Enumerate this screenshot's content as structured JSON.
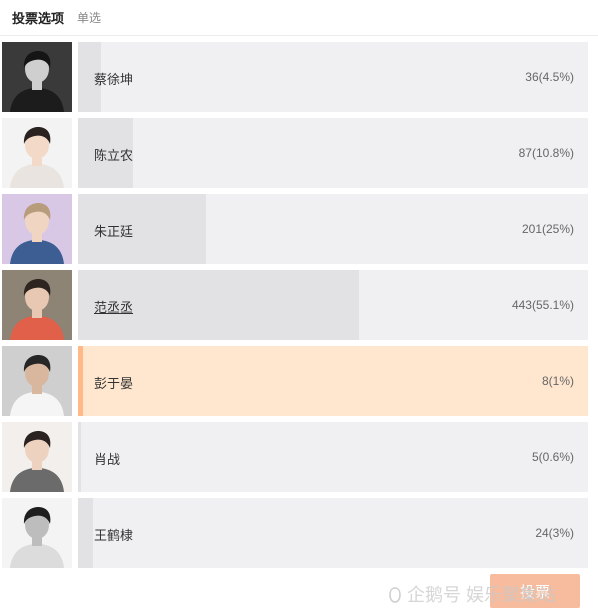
{
  "header": {
    "title": "投票选项",
    "mode": "单选"
  },
  "options": [
    {
      "name": "蔡徐坤",
      "votes": 36,
      "percent": 4.5,
      "stat": "36(4.5%)",
      "selected": false,
      "underlined": false,
      "avatar": {
        "bg": "#3a3a3a",
        "shirt": "#1c1c1c",
        "skin": "#cfcfcf",
        "hair": "#151515"
      }
    },
    {
      "name": "陈立农",
      "votes": 87,
      "percent": 10.8,
      "stat": "87(10.8%)",
      "selected": false,
      "underlined": false,
      "avatar": {
        "bg": "#f3f3f3",
        "shirt": "#e9e4e0",
        "skin": "#f3d9c7",
        "hair": "#2a2220"
      }
    },
    {
      "name": "朱正廷",
      "votes": 201,
      "percent": 25,
      "stat": "201(25%)",
      "selected": false,
      "underlined": false,
      "avatar": {
        "bg": "#d9c7e6",
        "shirt": "#3d5e92",
        "skin": "#f0d5c3",
        "hair": "#b89d7d"
      }
    },
    {
      "name": "范丞丞",
      "votes": 443,
      "percent": 55.1,
      "stat": "443(55.1%)",
      "selected": false,
      "underlined": true,
      "avatar": {
        "bg": "#8e8475",
        "shirt": "#e0604a",
        "skin": "#e8c8b2",
        "hair": "#2d2520"
      }
    },
    {
      "name": "彭于晏",
      "votes": 8,
      "percent": 1,
      "stat": "8(1%)",
      "selected": true,
      "underlined": false,
      "avatar": {
        "bg": "#cfcfcf",
        "shirt": "#f5f5f5",
        "skin": "#d9b79e",
        "hair": "#262626"
      }
    },
    {
      "name": "肖战",
      "votes": 5,
      "percent": 0.6,
      "stat": "5(0.6%)",
      "selected": false,
      "underlined": false,
      "avatar": {
        "bg": "#f2efec",
        "shirt": "#6b6b6b",
        "skin": "#ecd2bf",
        "hair": "#2a2220"
      }
    },
    {
      "name": "王鹤棣",
      "votes": 24,
      "percent": 3,
      "stat": "24(3%)",
      "selected": false,
      "underlined": false,
      "avatar": {
        "bg": "#f4f4f4",
        "shirt": "#dcdcdc",
        "skin": "#bdbdbd",
        "hair": "#1e1e1e"
      }
    }
  ],
  "submit": {
    "label": "投票"
  },
  "watermark": {
    "text": "企鹅号 娱乐聚集站"
  },
  "colors": {
    "bar_bg": "#f0f0f2",
    "bar_fill": "#e2e2e4",
    "selected_bg": "#ffe6cf",
    "selected_fill": "#ffb989",
    "button": "#f7b493"
  }
}
